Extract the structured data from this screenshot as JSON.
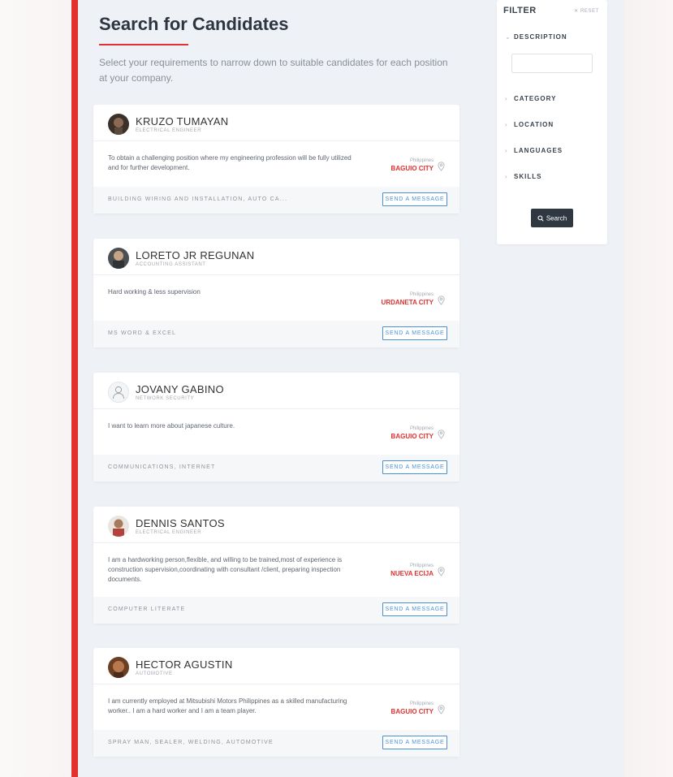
{
  "page": {
    "title": "Search for Candidates",
    "subtitle": "Select your requirements to narrow down to suitable candidates for each position at your company.",
    "accent": "#e2302f",
    "link_color": "#4a90d9"
  },
  "filter": {
    "title": "FILTER",
    "reset_label": "✕ RESET",
    "sections": [
      {
        "label": "DESCRIPTION",
        "expanded": true
      },
      {
        "label": "CATEGORY",
        "expanded": false
      },
      {
        "label": "LOCATION",
        "expanded": false
      },
      {
        "label": "LANGUAGES",
        "expanded": false
      },
      {
        "label": "SKILLS",
        "expanded": false
      }
    ],
    "description_value": "",
    "search_label": "Search"
  },
  "candidates": [
    {
      "name": "KRUZO TUMAYAN",
      "title": "ELECTRICAL ENGINEER",
      "summary": "To obtain a challenging position where my engineering profession will be fully utilized and for further development.",
      "country": "Philippines",
      "city": "BAGUIO CITY",
      "skills": "BUILDING WIRING AND INSTALLATION, AUTO CA...",
      "button": "SEND A MESSAGE",
      "avatar": "photo"
    },
    {
      "name": "LORETO JR REGUNAN",
      "title": "ACCOUNTING ASSISTANT",
      "summary": "Hard working & less supervision",
      "country": "Philippines",
      "city": "URDANETA CITY",
      "skills": "MS WORD & EXCEL",
      "button": "SEND A MESSAGE",
      "avatar": "photo"
    },
    {
      "name": "JOVANY GABINO",
      "title": "NETWORK SECURITY",
      "summary": "I want to learn more about japanese culture.",
      "country": "Philippines",
      "city": "BAGUIO CITY",
      "skills": "COMMUNICATIONS, INTERNET",
      "button": "SEND A MESSAGE",
      "avatar": "placeholder"
    },
    {
      "name": "DENNIS SANTOS",
      "title": "ELECTRICAL ENGINEER",
      "summary": "I am a hardworking person,flexible, and willing to be trained,most of experience is construction supervision,coordinating with consultant /client, preparing inspection documents.",
      "country": "Philippines",
      "city": "NUEVA ECIJA",
      "skills": "COMPUTER LITERATE",
      "button": "SEND A MESSAGE",
      "avatar": "photo"
    },
    {
      "name": "HECTOR AGUSTIN",
      "title": "AUTOMOTIVE",
      "summary": "I am currently employed at Mitsubishi Motors Philippines as a skilled manufacturing worker.. I am a hard worker and I am a team player.",
      "country": "Philippines",
      "city": "BAGUIO CITY",
      "skills": "SPRAY MAN, SEALER, WELDING, AUTOMOTIVE",
      "button": "SEND A MESSAGE",
      "avatar": "photo"
    }
  ]
}
